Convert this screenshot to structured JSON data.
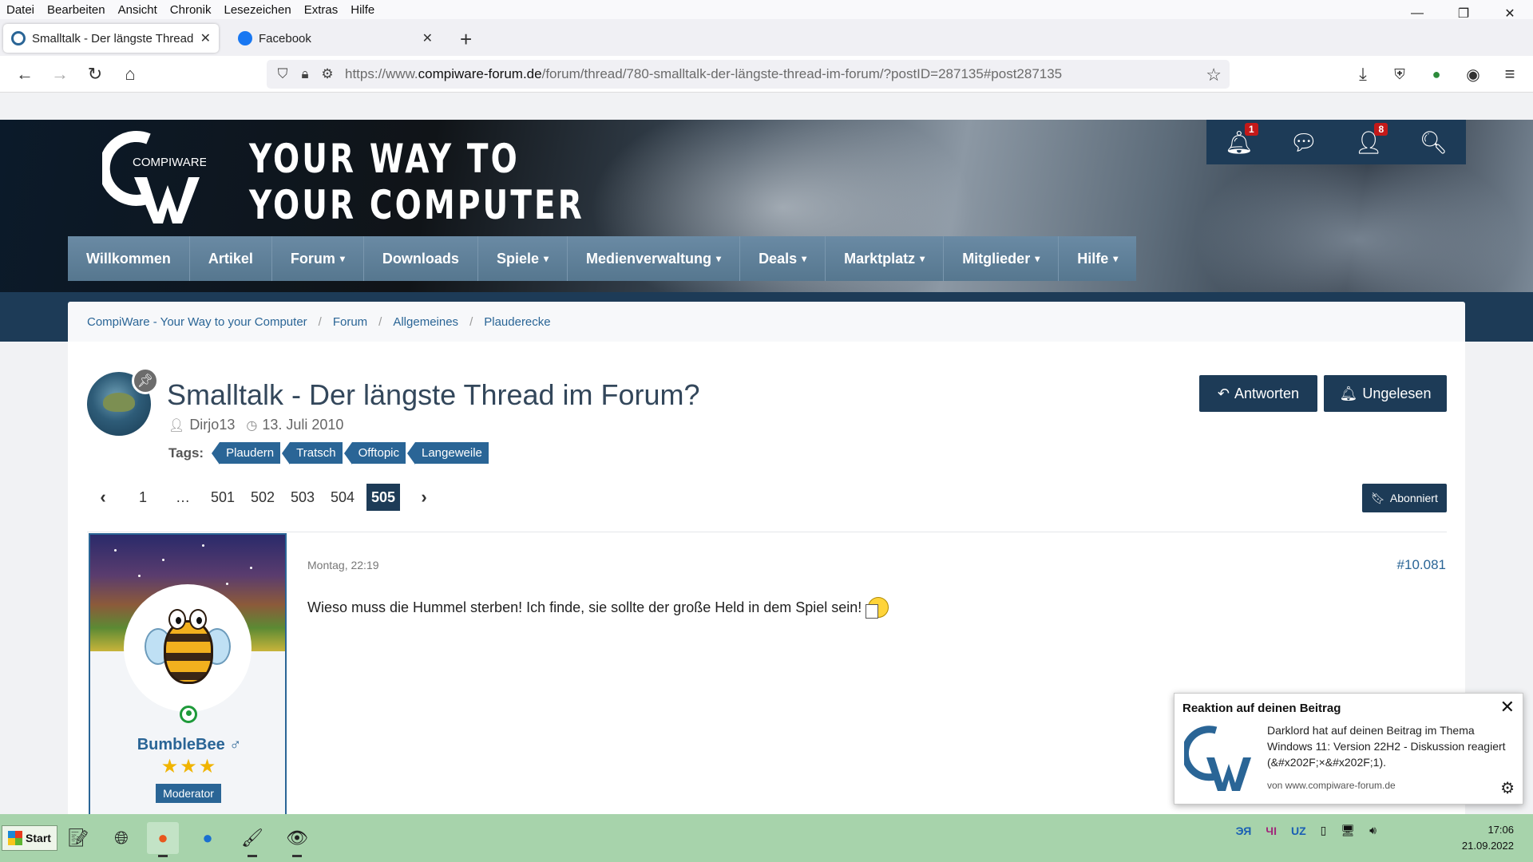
{
  "browser": {
    "menu": [
      "Datei",
      "Bearbeiten",
      "Ansicht",
      "Chronik",
      "Lesezeichen",
      "Extras",
      "Hilfe"
    ],
    "tabs": [
      {
        "title": "Smalltalk - Der längste Thread"
      },
      {
        "title": "Facebook"
      }
    ],
    "url_prefix": "https://www.",
    "url_domain": "compiware-forum.de",
    "url_path": "/forum/thread/780-smalltalk-der-längste-thread-im-forum/?postID=287135#post287135"
  },
  "site": {
    "logo_text": "COMPIWARE",
    "slogan_line1": "YOUR WAY TO",
    "slogan_line2": "YOUR COMPUTER",
    "notifications_count": "1",
    "members_count": "8",
    "nav": [
      {
        "label": "Willkommen",
        "chev": ""
      },
      {
        "label": "Artikel",
        "chev": ""
      },
      {
        "label": "Forum",
        "chev": "▾"
      },
      {
        "label": "Downloads",
        "chev": ""
      },
      {
        "label": "Spiele",
        "chev": "▾"
      },
      {
        "label": "Medienverwaltung",
        "chev": "▾"
      },
      {
        "label": "Deals",
        "chev": "▾"
      },
      {
        "label": "Marktplatz",
        "chev": "▾"
      },
      {
        "label": "Mitglieder",
        "chev": "▾"
      },
      {
        "label": "Hilfe",
        "chev": "▾"
      }
    ],
    "breadcrumb": [
      "CompiWare - Your Way to your Computer",
      "Forum",
      "Allgemeines",
      "Plauderecke"
    ]
  },
  "thread": {
    "title": "Smalltalk - Der längste Thread im Forum?",
    "author": "Dirjo13",
    "date": "13. Juli 2010",
    "tags_label": "Tags:",
    "tags": [
      "Plaudern",
      "Tratsch",
      "Offtopic",
      "Langeweile"
    ],
    "reply_label": "Antworten",
    "unread_label": "Ungelesen",
    "subscribed_label": "Abonniert",
    "pages": [
      "1",
      "…",
      "501",
      "502",
      "503",
      "504",
      "505"
    ],
    "current_page": "505"
  },
  "post": {
    "username": "BumbleBee ♂",
    "rank": "Moderator",
    "stars": "★★★",
    "date": "Montag, 22:19",
    "number": "#10.081",
    "text": "Wieso muss die Hummel sterben! Ich finde, sie sollte der große Held in dem Spiel sein!"
  },
  "notification": {
    "title": "Reaktion auf deinen Beitrag",
    "body": "Darklord hat auf deinen Beitrag im Thema Windows 11: Version 22H2 - Diskussion reagiert (&#x202F;×&#x202F;1).",
    "source": "von www.compiware-forum.de"
  },
  "taskbar": {
    "start_label": "Start",
    "tray_lang1": "ЭЯ",
    "tray_lang2": "ЧI",
    "tray_lang3": "UZ",
    "time": "17:06",
    "date": "21.09.2022"
  }
}
